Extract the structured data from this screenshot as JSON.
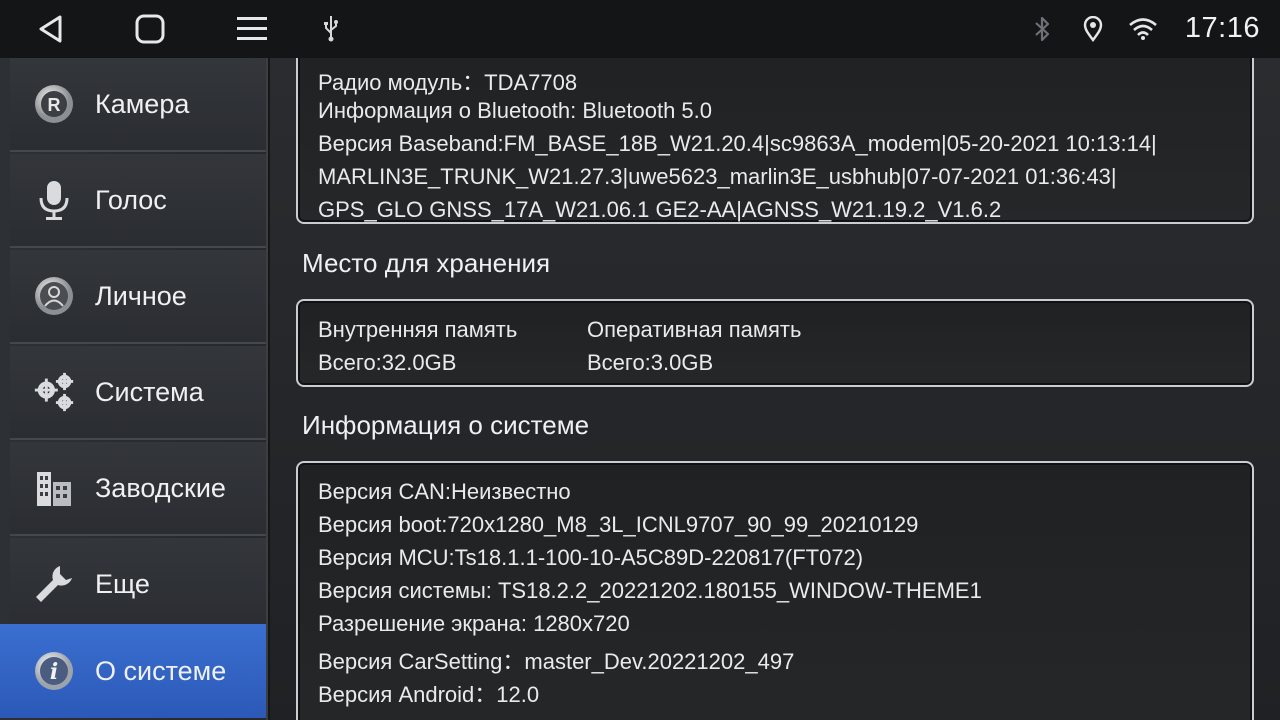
{
  "status_bar": {
    "nav": [
      "back-icon",
      "home-icon",
      "menu-icon"
    ],
    "usb_icon": "usb-icon",
    "right_icons": [
      "bluetooth-icon",
      "location-icon",
      "wifi-icon"
    ],
    "time": "17:16"
  },
  "sidebar": {
    "items": [
      {
        "label": "Камера",
        "icon": "camera-r-icon"
      },
      {
        "label": "Голос",
        "icon": "microphone-icon"
      },
      {
        "label": "Личное",
        "icon": "person-icon"
      },
      {
        "label": "Система",
        "icon": "gears-icon"
      },
      {
        "label": "Заводские",
        "icon": "factory-icon"
      },
      {
        "label": "Еще",
        "icon": "wrench-icon"
      },
      {
        "label": "О системе",
        "icon": "info-icon",
        "active": true
      }
    ]
  },
  "radio_card": {
    "radio_module": "Радио модуль：TDA7708",
    "bluetooth_info": "Информация о Bluetooth: Bluetooth 5.0",
    "baseband_1": "Версия Baseband:FM_BASE_18B_W21.20.4|sc9863A_modem|05-20-2021 10:13:14|",
    "baseband_2": "MARLIN3E_TRUNK_W21.27.3|uwe5623_marlin3E_usbhub|07-07-2021 01:36:43|",
    "baseband_3": "GPS_GLO GNSS_17A_W21.06.1 GE2-AA|AGNSS_W21.19.2_V1.6.2"
  },
  "storage": {
    "title": "Место для хранения",
    "internal_label": "Внутренняя память",
    "internal_total": "Всего:32.0GB",
    "ram_label": "Оперативная память",
    "ram_total": "Всего:3.0GB"
  },
  "system_info": {
    "title": "Информация о системе",
    "lines": [
      "Версия CAN:Неизвестно",
      "Версия  boot:720x1280_M8_3L_ICNL9707_90_99_20210129",
      "Версия MCU:Ts18.1.1-100-10-A5C89D-220817(FT072)",
      "Версия системы: TS18.2.2_20221202.180155_WINDOW-THEME1",
      "Разрешение экрана: 1280x720",
      "Версия CarSetting：master_Dev.20221202_497",
      "Версия Android：12.0"
    ]
  }
}
